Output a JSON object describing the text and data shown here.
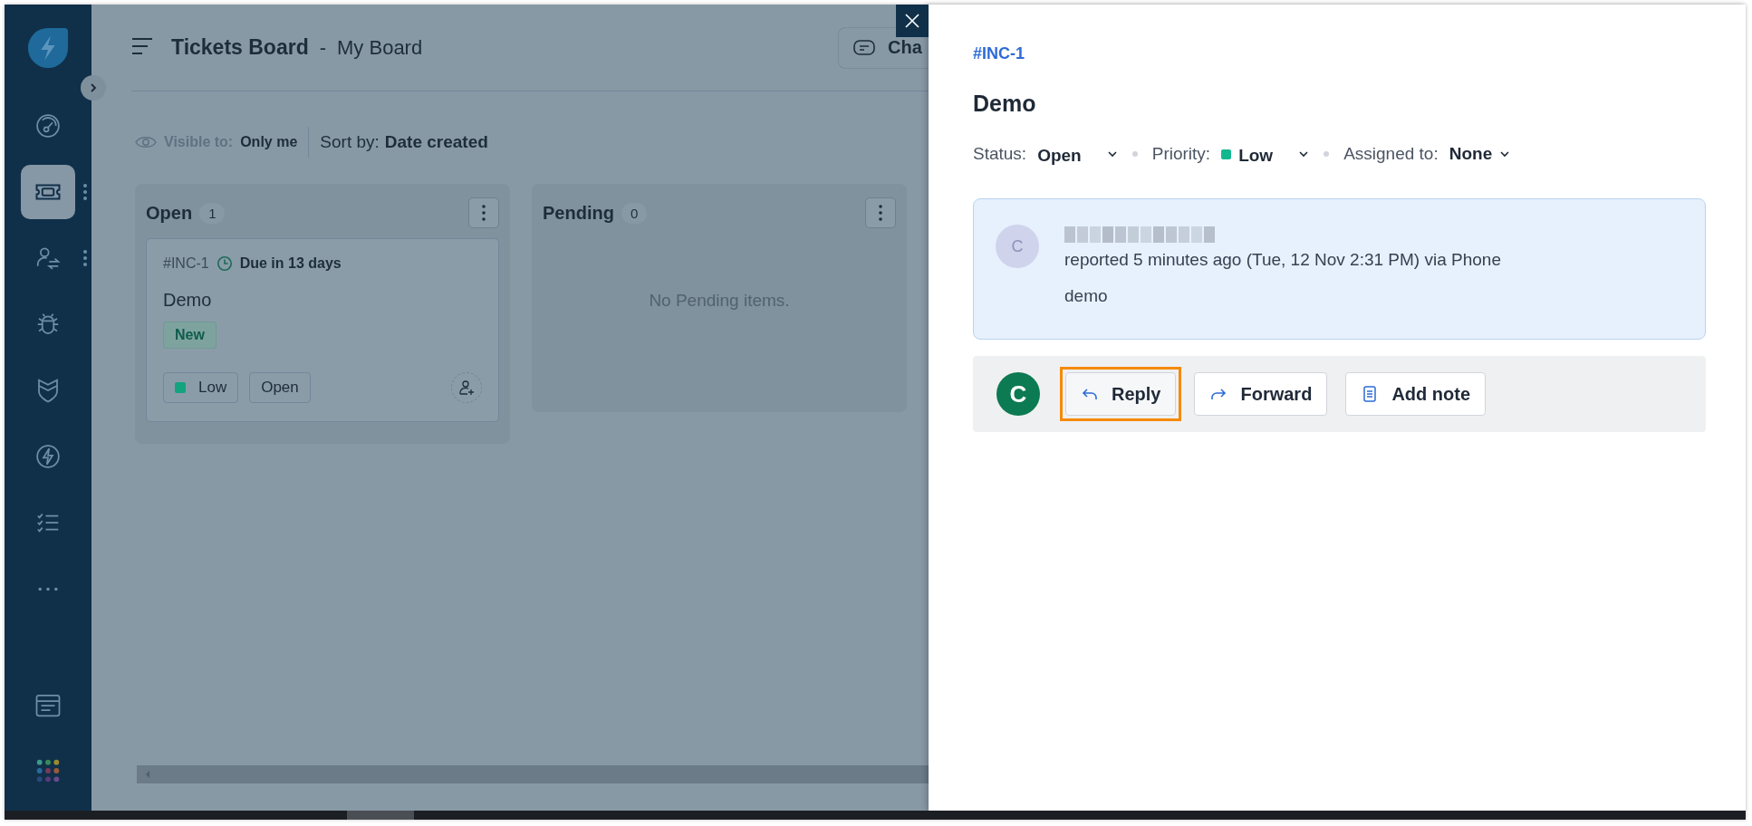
{
  "sidebar": {
    "items": [
      {
        "kind": "dashboard",
        "selected": false,
        "more": false
      },
      {
        "kind": "tickets",
        "selected": true,
        "more": true
      },
      {
        "kind": "contacts",
        "selected": false,
        "more": true
      },
      {
        "kind": "bug",
        "selected": false,
        "more": false
      },
      {
        "kind": "shield",
        "selected": false,
        "more": false
      },
      {
        "kind": "bolt",
        "selected": false,
        "more": false
      },
      {
        "kind": "checklist",
        "selected": false,
        "more": false
      },
      {
        "kind": "more",
        "selected": false,
        "more": false
      }
    ],
    "bottom_items": [
      {
        "kind": "browser",
        "selected": false
      },
      {
        "kind": "apps",
        "selected": false
      }
    ]
  },
  "header": {
    "title": "Tickets Board",
    "separator": "-",
    "board": "My Board",
    "chat_button": "Cha"
  },
  "filters": {
    "visible_label": "Visible to:",
    "visible_value": "Only me",
    "sort_label": "Sort by:",
    "sort_value": "Date created"
  },
  "columns": [
    {
      "title": "Open",
      "count": "1",
      "cards": [
        {
          "id": "#INC-1",
          "due": "Due in 13 days",
          "title": "Demo",
          "tag": "New",
          "priority": "Low",
          "color": "#14a37f",
          "status": "Open"
        }
      ]
    },
    {
      "title": "Pending",
      "count": "0",
      "empty_text": "No Pending items."
    }
  ],
  "detail": {
    "id": "#INC-1",
    "title": "Demo",
    "fields": [
      {
        "label": "Status:",
        "value": "Open"
      },
      {
        "label": "Priority:",
        "value": "Low",
        "color": "#14b88f"
      },
      {
        "label": "Assigned to:",
        "value": "None"
      }
    ],
    "message": {
      "avatar": "C",
      "meta": "reported 5 minutes ago (Tue, 12 Nov 2:31 PM) via Phone",
      "body": "demo"
    },
    "composer": {
      "avatar": "C",
      "actions": [
        {
          "kind": "reply",
          "label": "Reply",
          "highlighted": true
        },
        {
          "kind": "forward",
          "label": "Forward",
          "highlighted": false
        },
        {
          "kind": "note",
          "label": "Add note",
          "highlighted": false
        }
      ]
    }
  }
}
